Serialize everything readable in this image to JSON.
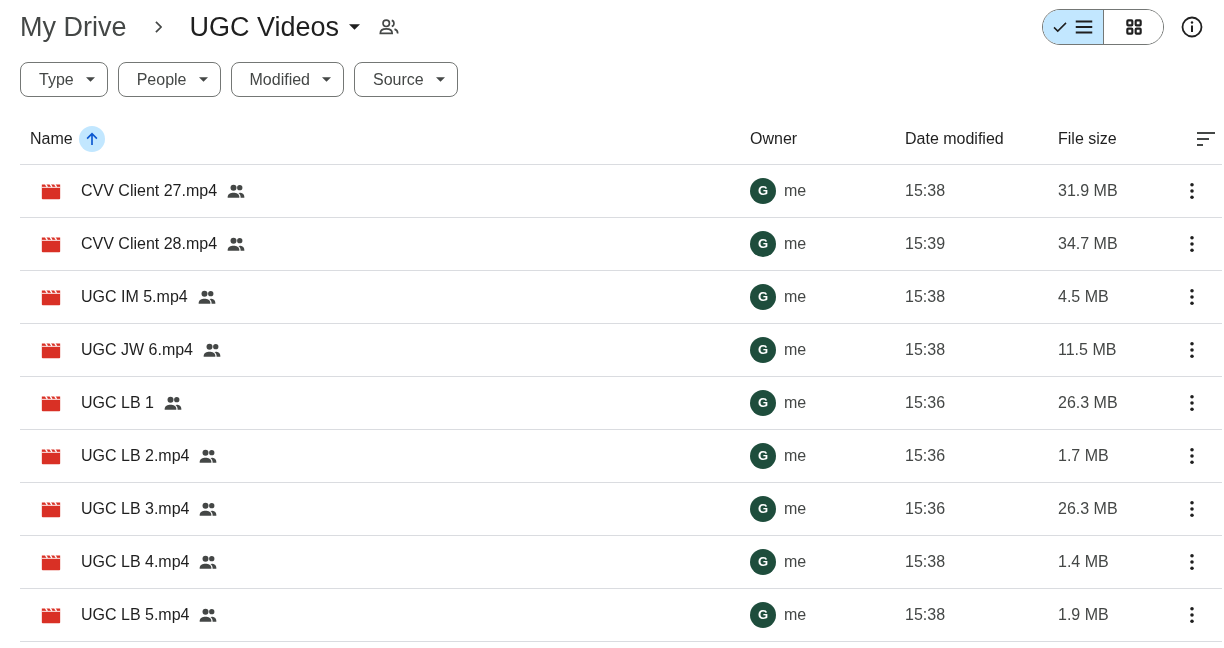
{
  "breadcrumb": [
    {
      "label": "My Drive",
      "current": false
    },
    {
      "label": "UGC Videos",
      "current": true
    }
  ],
  "view_toggle": [
    {
      "kind": "list",
      "selected": true
    },
    {
      "kind": "grid",
      "selected": false
    }
  ],
  "filters": [
    "Type",
    "People",
    "Modified",
    "Source"
  ],
  "table": {
    "columns": [
      {
        "label": "Name",
        "sorted": true
      },
      {
        "label": "Owner",
        "sorted": false
      },
      {
        "label": "Date modified",
        "sorted": false
      },
      {
        "label": "File size",
        "sorted": false
      }
    ],
    "rows": [
      {
        "name": "CVV Client 27.mp4",
        "shared": true,
        "avatar": "G",
        "owner": "me",
        "modified": "15:38",
        "size": "31.9 MB"
      },
      {
        "name": "CVV Client 28.mp4",
        "shared": true,
        "avatar": "G",
        "owner": "me",
        "modified": "15:39",
        "size": "34.7 MB"
      },
      {
        "name": "UGC IM 5.mp4",
        "shared": true,
        "avatar": "G",
        "owner": "me",
        "modified": "15:38",
        "size": "4.5 MB"
      },
      {
        "name": "UGC JW 6.mp4",
        "shared": true,
        "avatar": "G",
        "owner": "me",
        "modified": "15:38",
        "size": "11.5 MB"
      },
      {
        "name": "UGC LB 1",
        "shared": true,
        "avatar": "G",
        "owner": "me",
        "modified": "15:36",
        "size": "26.3 MB"
      },
      {
        "name": "UGC LB 2.mp4",
        "shared": true,
        "avatar": "G",
        "owner": "me",
        "modified": "15:36",
        "size": "1.7 MB"
      },
      {
        "name": "UGC LB 3.mp4",
        "shared": true,
        "avatar": "G",
        "owner": "me",
        "modified": "15:36",
        "size": "26.3 MB"
      },
      {
        "name": "UGC LB 4.mp4",
        "shared": true,
        "avatar": "G",
        "owner": "me",
        "modified": "15:38",
        "size": "1.4 MB"
      },
      {
        "name": "UGC LB 5.mp4",
        "shared": true,
        "avatar": "G",
        "owner": "me",
        "modified": "15:38",
        "size": "1.9 MB"
      }
    ]
  }
}
